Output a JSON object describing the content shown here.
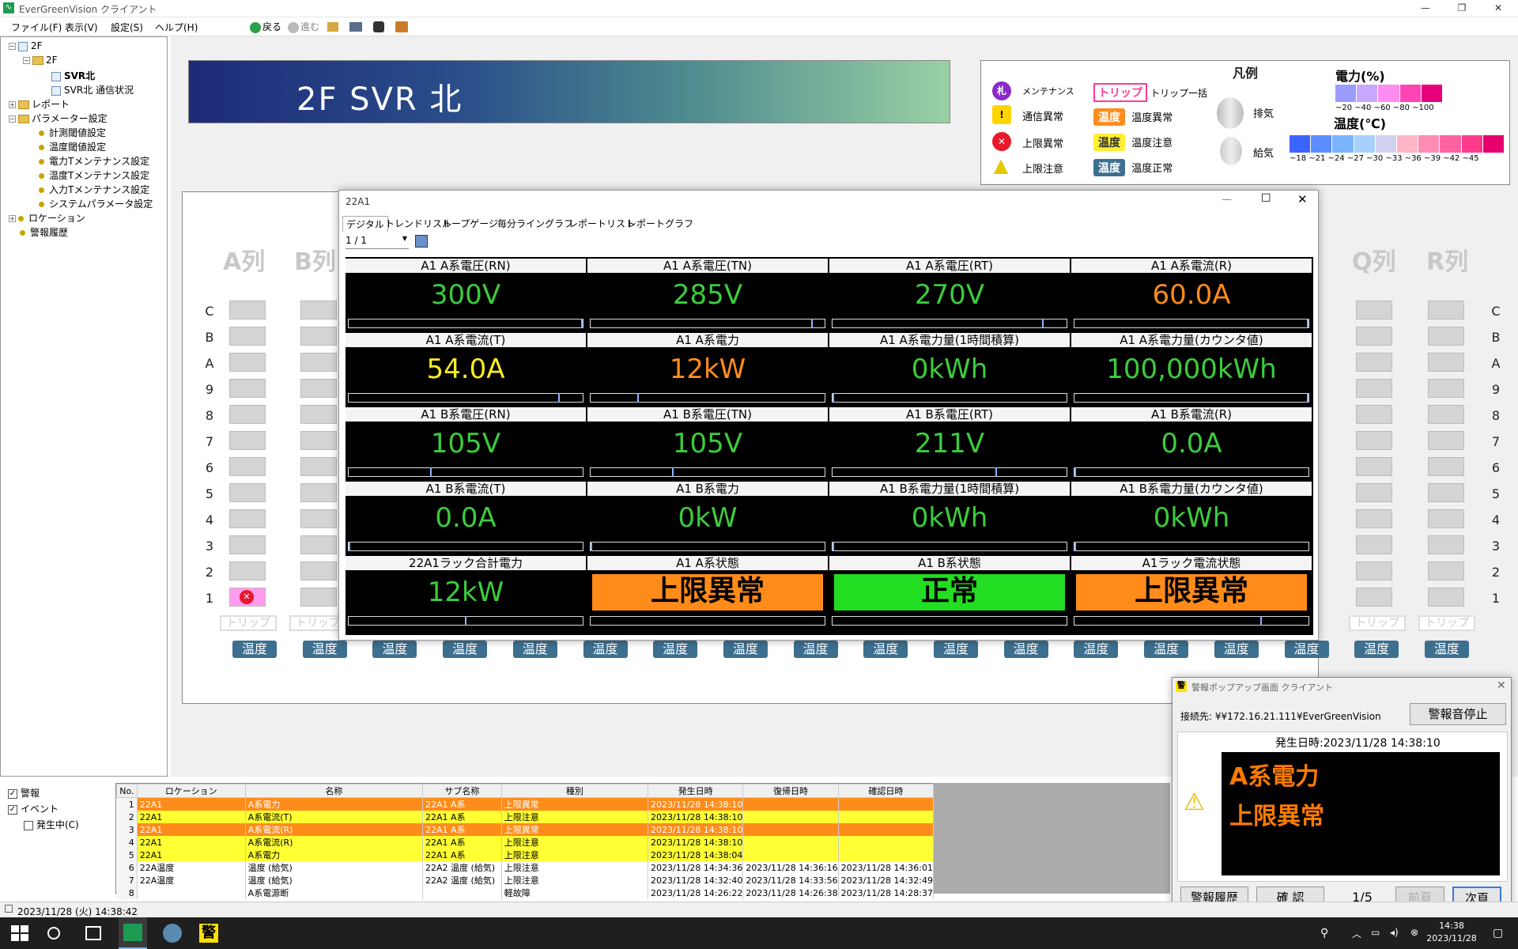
{
  "window": {
    "title": "EverGreenVision クライアント"
  },
  "menu": [
    "ファイル(F)",
    "表示(V)",
    "設定(S)",
    "ヘルプ(H)"
  ],
  "toolbar": {
    "back": "戻る",
    "forward": "進む"
  },
  "tree": {
    "root": "2F",
    "floor": "2F",
    "page_selected": "SVR北",
    "page_comm": "SVR北 通信状況",
    "report": "レポート",
    "params": "パラメーター設定",
    "param_items": [
      "計測閾値設定",
      "温度閾値設定",
      "電力Tメンテナンス設定",
      "温度Tメンテナンス設定",
      "入力Tメンテナンス設定",
      "システムパラメータ設定"
    ],
    "location": "ロケーション",
    "alarm_history": "警報履歴"
  },
  "banner": {
    "title": "2F SVR 北"
  },
  "legend": {
    "title": "凡例",
    "maintenance": "メンテナンス",
    "comm_error": "通信異常",
    "upper_error": "上限異常",
    "upper_warning": "上限注意",
    "trip_badge": "トリップ",
    "trip_all": "トリップ一括",
    "temp_badge": "温度",
    "temp_error": "温度異常",
    "temp_warning": "温度注意",
    "temp_normal": "温度正常",
    "exhaust": "排気",
    "supply": "給気",
    "power_title": "電力(%)",
    "power_scale": "~20 ~40 ~60 ~80 ~100",
    "power_colors": [
      "#9c9cff",
      "#c8a8ff",
      "#ff8cf0",
      "#ff44b4",
      "#e6007e"
    ],
    "temp_title": "温度(℃)",
    "temp_scale": "~18 ~21 ~24 ~27 ~30 ~33 ~36 ~39 ~42 ~45",
    "temp_colors": [
      "#3c64ff",
      "#5a8cff",
      "#7ab4ff",
      "#a8d0ff",
      "#d2d2f0",
      "#ffb4c8",
      "#ff8cb4",
      "#ff64a0",
      "#ff3c8c",
      "#e6006e"
    ]
  },
  "floor": {
    "columns_left": [
      "A列",
      "B列"
    ],
    "columns_right": [
      "Q列",
      "R列"
    ],
    "rows": [
      "C",
      "B",
      "A",
      "9",
      "8",
      "7",
      "6",
      "5",
      "4",
      "3",
      "2",
      "1"
    ],
    "trip_label": "トリップ",
    "temp_label": "温度"
  },
  "digital": {
    "window_title": "22A1",
    "tabs": [
      "デジタル",
      "トレンドリスト",
      "ループゲージ",
      "毎分ライングラフ",
      "レポートリスト",
      "レポートグラフ"
    ],
    "pager": "1 / 1",
    "cells": [
      {
        "title": "A1 A系電圧(RN)",
        "value": "300V",
        "color": "#3ccc3c",
        "bar": 1.0
      },
      {
        "title": "A1 A系電圧(TN)",
        "value": "285V",
        "color": "#3ccc3c",
        "bar": 0.95
      },
      {
        "title": "A1 A系電圧(RT)",
        "value": "270V",
        "color": "#3ccc3c",
        "bar": 0.9
      },
      {
        "title": "A1 A系電流(R)",
        "value": "60.0A",
        "color": "#ff8c1a",
        "bar": 1.0
      },
      {
        "title": "A1 A系電流(T)",
        "value": "54.0A",
        "color": "#ffee22",
        "bar": 0.9
      },
      {
        "title": "A1 A系電力",
        "value": "12kW",
        "color": "#ff8c1a",
        "bar": 0.2
      },
      {
        "title": "A1 A系電力量(1時間積算)",
        "value": "0kWh",
        "color": "#3ccc3c",
        "bar": 0.0
      },
      {
        "title": "A1 A系電力量(カウンタ値)",
        "value": "100,000kWh",
        "color": "#3ccc3c",
        "bar": 1.0
      },
      {
        "title": "A1 B系電圧(RN)",
        "value": "105V",
        "color": "#3ccc3c",
        "bar": 0.35
      },
      {
        "title": "A1 B系電圧(TN)",
        "value": "105V",
        "color": "#3ccc3c",
        "bar": 0.35
      },
      {
        "title": "A1 B系電圧(RT)",
        "value": "211V",
        "color": "#3ccc3c",
        "bar": 0.7
      },
      {
        "title": "A1 B系電流(R)",
        "value": "0.0A",
        "color": "#3ccc3c",
        "bar": 0.0
      },
      {
        "title": "A1 B系電流(T)",
        "value": "0.0A",
        "color": "#3ccc3c",
        "bar": 0.0
      },
      {
        "title": "A1 B系電力",
        "value": "0kW",
        "color": "#3ccc3c",
        "bar": 0.0
      },
      {
        "title": "A1 B系電力量(1時間積算)",
        "value": "0kWh",
        "color": "#3ccc3c",
        "bar": 0.0
      },
      {
        "title": "A1 B系電力量(カウンタ値)",
        "value": "0kWh",
        "color": "#3ccc3c",
        "bar": 0.0
      },
      {
        "title": "22A1ラック合計電力",
        "value": "12kW",
        "color": "#3ccc3c",
        "bar": 0.5
      }
    ],
    "statuses": [
      {
        "title": "A1 A系状態",
        "value": "上限異常",
        "bg": "#ff8c1a"
      },
      {
        "title": "A1 B系状態",
        "value": "正常",
        "bg": "#22dd22"
      },
      {
        "title": "A1ラック電流状態",
        "value": "上限異常",
        "bg": "#ff8c1a",
        "bar": 0.8
      }
    ]
  },
  "filters": {
    "alarm": "警報",
    "event": "イベント",
    "occurring": "発生中(C)"
  },
  "alarm_table": {
    "headers": [
      "No.",
      "ロケーション",
      "名称",
      "サブ名称",
      "種別",
      "発生日時",
      "復帰日時",
      "確認日時"
    ],
    "rows": [
      {
        "no": "1",
        "loc": "22A1",
        "name": "A系電力",
        "sub": "22A1 A系",
        "type": "上限異常",
        "occurred": "2023/11/28 14:38:10",
        "recovered": "",
        "confirmed": "",
        "style": "orange"
      },
      {
        "no": "2",
        "loc": "22A1",
        "name": "A系電流(T)",
        "sub": "22A1 A系",
        "type": "上限注意",
        "occurred": "2023/11/28 14:38:10",
        "recovered": "",
        "confirmed": "",
        "style": "yellow"
      },
      {
        "no": "3",
        "loc": "22A1",
        "name": "A系電流(R)",
        "sub": "22A1 A系",
        "type": "上限異常",
        "occurred": "2023/11/28 14:38:10",
        "recovered": "",
        "confirmed": "",
        "style": "orange"
      },
      {
        "no": "4",
        "loc": "22A1",
        "name": "A系電流(R)",
        "sub": "22A1 A系",
        "type": "上限注意",
        "occurred": "2023/11/28 14:38:10",
        "recovered": "",
        "confirmed": "",
        "style": "yellow"
      },
      {
        "no": "5",
        "loc": "22A1",
        "name": "A系電力",
        "sub": "22A1 A系",
        "type": "上限注意",
        "occurred": "2023/11/28 14:38:04",
        "recovered": "",
        "confirmed": "",
        "style": "yellow"
      },
      {
        "no": "6",
        "loc": "22A温度",
        "name": "温度 (給気)",
        "sub": "22A2 温度 (給気)",
        "type": "上限注意",
        "occurred": "2023/11/28 14:34:36",
        "recovered": "2023/11/28 14:36:16",
        "confirmed": "2023/11/28 14:36:01",
        "style": "white"
      },
      {
        "no": "7",
        "loc": "22A温度",
        "name": "温度 (給気)",
        "sub": "22A2 温度 (給気)",
        "type": "上限注意",
        "occurred": "2023/11/28 14:32:40",
        "recovered": "2023/11/28 14:33:56",
        "confirmed": "2023/11/28 14:32:49",
        "style": "white"
      },
      {
        "no": "8",
        "loc": "",
        "name": "A系電源断",
        "sub": "",
        "type": "軽故障",
        "occurred": "2023/11/28 14:26:22",
        "recovered": "2023/11/28 14:26:38",
        "confirmed": "2023/11/28 14:28:37",
        "style": "white"
      }
    ]
  },
  "popup": {
    "title": "警報ポップアップ画面 クライアント",
    "connection": "接続先: ¥¥172.16.21.111¥EverGreenVision",
    "stop_sound": "警報音停止",
    "datetime": "発生日時:2023/11/28 14:38:10",
    "line1": "A系電力",
    "line2": "上限異常",
    "history": "警報履歴",
    "confirm": "確 認",
    "counter": "1/5",
    "prev": "前頁",
    "next": "次頁"
  },
  "statusbar": {
    "datetime": "2023/11/28 (火) 14:38:42"
  },
  "taskbar": {
    "time": "14:38",
    "date": "2023/11/28"
  }
}
